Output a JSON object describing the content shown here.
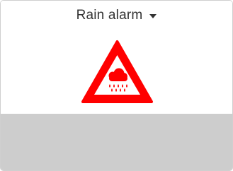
{
  "widget": {
    "title": "Rain alarm",
    "dropdown_icon": "caret-down-icon",
    "sign_icon": "warning-triangle-icon",
    "weather_icon": "rain-cloud-icon",
    "colors": {
      "warning_red": "#ff0000",
      "icon_fill": "#ffffff",
      "background_bottom": "#cdcdcd",
      "text": "#333333"
    }
  }
}
